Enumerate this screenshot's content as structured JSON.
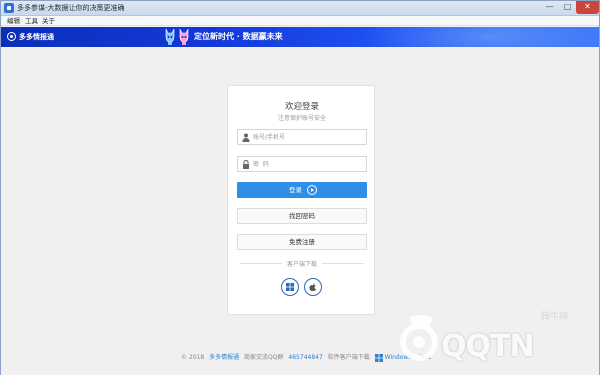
{
  "window": {
    "title": "多多参谋-大数据让你的决策更准确",
    "controls": {
      "minimize": "—",
      "maximize": "□",
      "close": "✕"
    }
  },
  "menu": [
    "编辑",
    "工具",
    "关于"
  ],
  "banner": {
    "brand": "多多情报通",
    "slogan": "定位新时代 · 数据赢未来"
  },
  "login": {
    "title": "欢迎登录",
    "subtitle": "注意保护账号安全",
    "account_placeholder": "账号/手机号",
    "password_placeholder": "密  码",
    "login_button": "登录",
    "recover_button": "找回密码",
    "register_button": "免费注册",
    "download_label": "客户端下载"
  },
  "icons": {
    "account": "user-icon",
    "password": "lock-icon",
    "login": "arrow-right-circle-icon",
    "windows": "windows-icon",
    "mac": "apple-icon"
  },
  "footer": {
    "copyright": "© 2018",
    "brand": "多多情报通",
    "qq_label": "商家交流QQ群",
    "qq_number": "465744847",
    "download_label": "软件客户端下载",
    "windows": "Windows",
    "mac": "Mac"
  },
  "watermark": {
    "text": "QQTN",
    "sub": "腾牛网"
  },
  "colors": {
    "accent": "#2f8ee6",
    "banner": "#1438d8",
    "link": "#2f7fd0",
    "os_border": "#2b6bbd"
  }
}
